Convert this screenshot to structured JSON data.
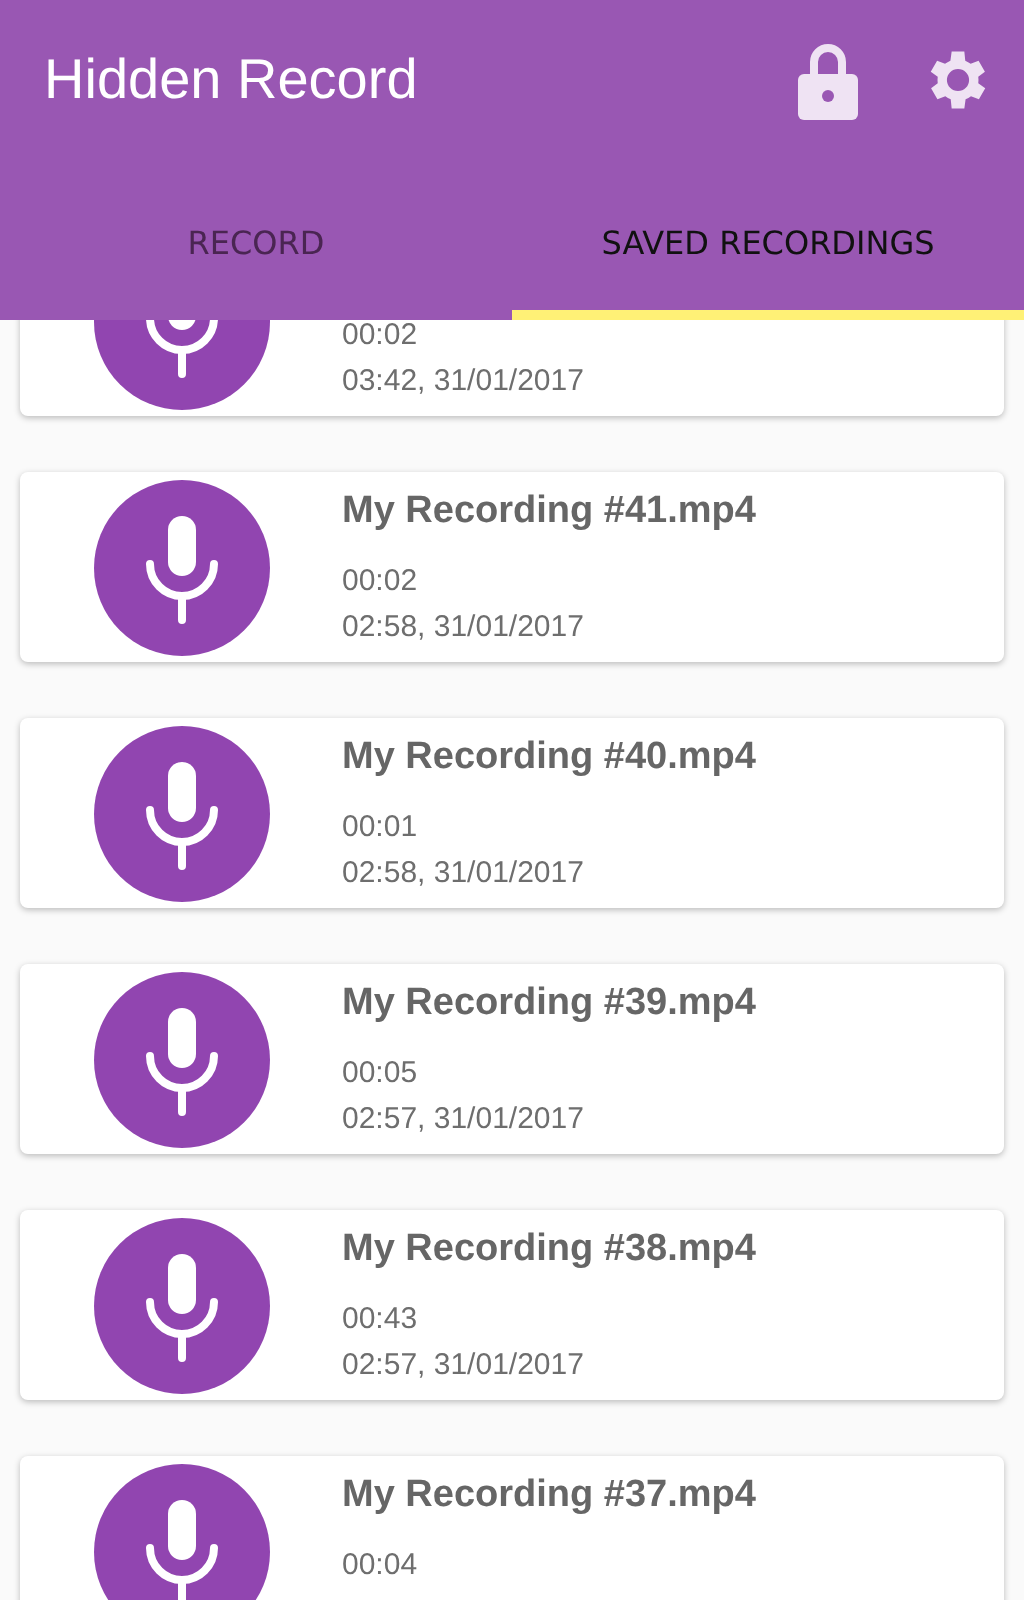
{
  "app_bar": {
    "title": "Hidden Record"
  },
  "tabs": [
    {
      "label": "RECORD",
      "selected": false
    },
    {
      "label": "SAVED RECORDINGS",
      "selected": true
    }
  ],
  "recordings": [
    {
      "duration": "00:02",
      "date": "03:42, 31/01/2017"
    },
    {
      "title": "My Recording #41.mp4",
      "duration": "00:02",
      "date": "02:58, 31/01/2017"
    },
    {
      "title": "My Recording #40.mp4",
      "duration": "00:01",
      "date": "02:58, 31/01/2017"
    },
    {
      "title": "My Recording #39.mp4",
      "duration": "00:05",
      "date": "02:57, 31/01/2017"
    },
    {
      "title": "My Recording #38.mp4",
      "duration": "00:43",
      "date": "02:57, 31/01/2017"
    },
    {
      "title": "My Recording #37.mp4",
      "duration": "00:04"
    }
  ]
}
